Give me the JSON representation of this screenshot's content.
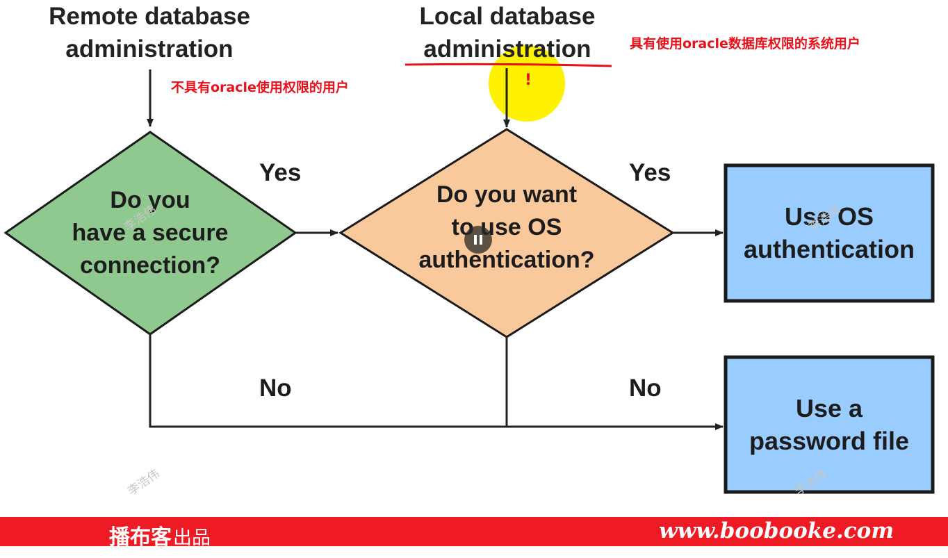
{
  "headers": {
    "remote": "Remote database\nadministration",
    "local": "Local database\nadministration"
  },
  "annotations": {
    "remote_note": "不具有oracle使用权限的用户",
    "local_note": "具有使用oracle数据库权限的系统用户",
    "exclaim": "!"
  },
  "decisions": {
    "secure": "Do you\nhave a secure\nconnection?",
    "os_auth": "Do you want\nto use OS\nauthentication?"
  },
  "outcomes": {
    "os": "Use OS\nauthentication",
    "password": "Use a\npassword file"
  },
  "edge_labels": {
    "yes_1": "Yes",
    "yes_2": "Yes",
    "no_1": "No",
    "no_2": "No"
  },
  "watermark": "李浩伟",
  "footer": {
    "brand": "播布客",
    "brand_suffix": "出品",
    "url": "www.boobooke.com"
  },
  "colors": {
    "decision_green": "#8fc98f",
    "decision_orange": "#f9c99c",
    "outcome_blue": "#99ccff",
    "highlight_yellow": "#fff200",
    "annotation_red": "#e8101a",
    "footer_red": "#ee1b24"
  },
  "icons": {
    "player": "pause-icon"
  }
}
